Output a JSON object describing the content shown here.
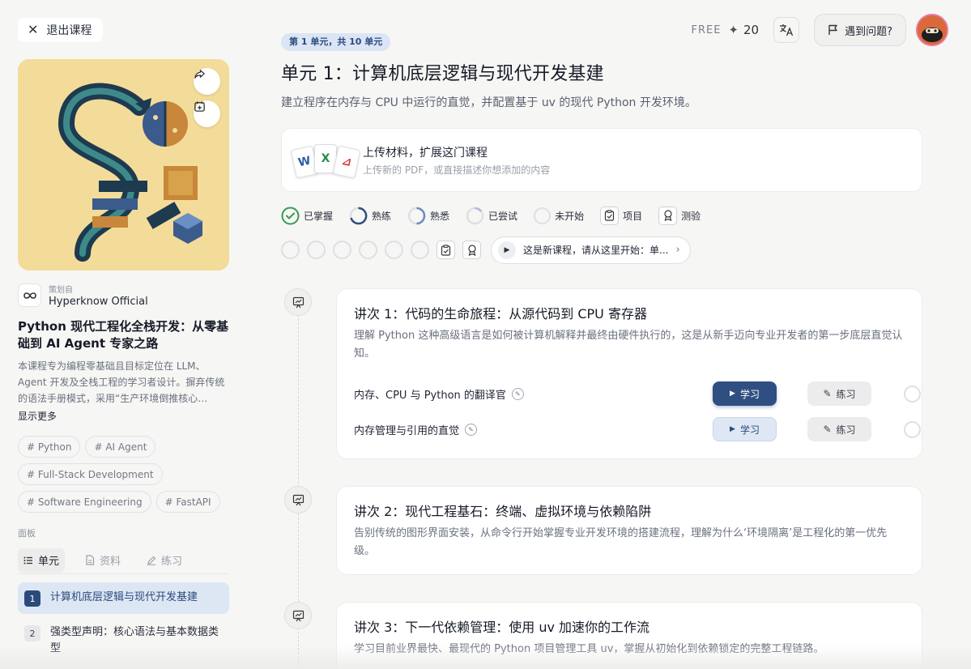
{
  "sidebar": {
    "exit_label": "退出课程",
    "curator_label": "策划自",
    "curator_name": "Hyperknow Official",
    "course_title": "Python 现代工程化全栈开发：从零基础到 AI Agent 专家之路",
    "course_desc": "本课程专为编程零基础且目标定位在 LLM、Agent 开发及全栈工程的学习者设计。摒弃传统的语法手册模式，采用“生产环境倒推核心…",
    "show_more": "显示更多",
    "tags": [
      "# Python",
      "# AI Agent",
      "# Full-Stack Development",
      "# Software Engineering",
      "# FastAPI"
    ],
    "panel_label": "面板",
    "panel_tabs": [
      {
        "label": "单元",
        "icon": "list-icon"
      },
      {
        "label": "资料",
        "icon": "document-icon"
      },
      {
        "label": "练习",
        "icon": "pencil-icon"
      }
    ],
    "units": [
      {
        "num": "1",
        "title": "计算机底层逻辑与现代开发基建"
      },
      {
        "num": "2",
        "title": "强类型声明：核心语法与基本数据类型"
      }
    ]
  },
  "topbar": {
    "plan": "FREE",
    "credits": "20",
    "problem_label": "遇到问题?"
  },
  "main": {
    "unit_badge": "第 1 单元，共 10 单元",
    "unit_title": "单元 1：计算机底层逻辑与现代开发基建",
    "unit_subtitle": "建立程序在内存与 CPU 中运行的直觉，并配置基于 uv 的现代 Python 开发环境。",
    "upload_title": "上传材料，扩展这门课程",
    "upload_sub": "上传新的 PDF，或直接描述你想添加的内容",
    "legend": [
      "已掌握",
      "熟练",
      "熟悉",
      "已尝试",
      "未开始",
      "项目",
      "测验"
    ],
    "start_hint": "这是新课程，请从这里开始：单..."
  },
  "lessons": [
    {
      "title": "讲次 1：代码的生命旅程：从源代码到 CPU 寄存器",
      "desc": "理解 Python 这种高级语言是如何被计算机解释并最终由硬件执行的，这是从新手迈向专业开发者的第一步底层直觉认知。",
      "topics": [
        {
          "name": "内存、CPU 与 Python 的翻译官",
          "learn": "学习",
          "practice": "练习"
        },
        {
          "name": "内存管理与引用的直觉",
          "learn": "学习",
          "practice": "练习"
        }
      ]
    },
    {
      "title": "讲次 2：现代工程基石：终端、虚拟环境与依赖陷阱",
      "desc": "告别传统的图形界面安装，从命令行开始掌握专业开发环境的搭建流程，理解为什么‘环境隔离’是工程化的第一优先级。"
    },
    {
      "title": "讲次 3：下一代依赖管理：使用 uv 加速你的工作流",
      "desc": "学习目前业界最快、最现代的 Python 项目管理工具 uv，掌握从初始化到依赖锁定的完整工程链路。"
    }
  ],
  "colors": {
    "accent": "#2f4f82",
    "accent_light": "#dfe7f4",
    "mastered": "#3a9a4f",
    "cover_bg": "#f3dc99"
  }
}
